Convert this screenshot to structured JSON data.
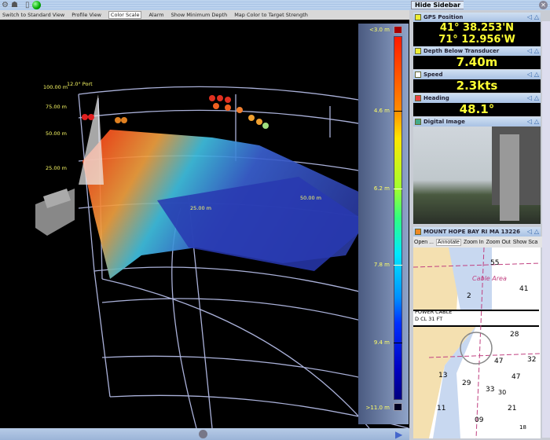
{
  "toolbar": {
    "hide_sidebar": "Hide Sidebar",
    "icons": [
      "gear-icon",
      "profile-icon",
      "document-icon",
      "status-green-icon",
      "close-icon"
    ]
  },
  "menu": [
    "Switch to Standard View",
    "Profile View",
    "Color Scale",
    "Alarm",
    "Show Minimum Depth",
    "Map Color to Target Strength"
  ],
  "view": {
    "range_labels": [
      "100.00 m",
      "75.00 m",
      "50.00 m",
      "25.00 m"
    ],
    "angle_label": "12.0° Port",
    "floor_labels": [
      "25.00 m",
      "50.00 m"
    ]
  },
  "legend": {
    "labels": [
      "<3.0 m",
      "4.6 m",
      "6.2 m",
      "7.8 m",
      "9.4 m",
      ">11.0 m"
    ]
  },
  "sidebar": {
    "gps": {
      "title": "GPS Position",
      "lat": "41° 38.253'N",
      "lon": "71° 12.956'W"
    },
    "depth": {
      "title": "Depth Below Transducer",
      "value": "7.40m"
    },
    "speed": {
      "title": "Speed",
      "value": "2.3kts"
    },
    "heading": {
      "title": "Heading",
      "value": "48.1°"
    },
    "image": {
      "title": "Digital Image"
    },
    "chart": {
      "title": "MOUNT HOPE BAY RI MA   13226",
      "tools": [
        "Open ...",
        "Annotate",
        "Zoom In",
        "Zoom Out",
        "Show Sca"
      ],
      "labels": [
        "55",
        "Cable Area",
        "41",
        "2",
        "POWER CABLE",
        "D CL 31 FT",
        "28",
        "47",
        "32",
        "13",
        "29",
        "33",
        "30",
        "47",
        "11",
        "21",
        "09",
        "18"
      ]
    }
  }
}
